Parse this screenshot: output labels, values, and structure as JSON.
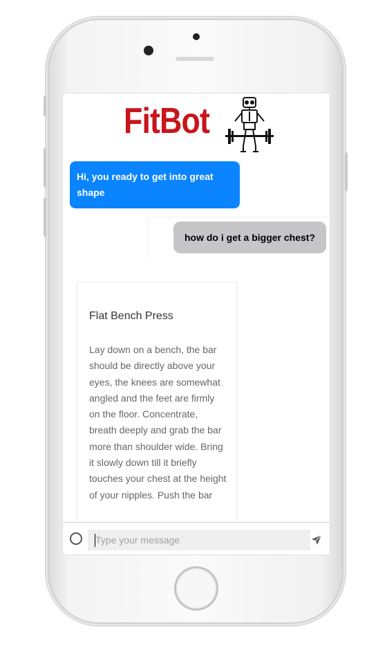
{
  "app": {
    "logo": "FitBot"
  },
  "chat": {
    "bot_greeting": "Hi, you ready to get into great shape",
    "user_message": "how do i get a bigger chest?",
    "card": {
      "title": "Flat Bench Press",
      "body": "Lay down on a bench, the bar should be directly above your eyes, the knees are somewhat angled and the feet are firmly on the floor. Concentrate, breath deeply and grab the bar more than shoulder wide. Bring it slowly down till it briefly touches your chest at the height of your nipples. Push the bar"
    }
  },
  "composer": {
    "placeholder": "Type your message"
  },
  "icons": {
    "attach": "circle-icon",
    "send": "send-icon",
    "robot": "robot-barbell-icon"
  },
  "colors": {
    "brand_red": "#c8151b",
    "bot_bubble": "#0a84ff",
    "user_bubble": "#c6c6c9"
  }
}
